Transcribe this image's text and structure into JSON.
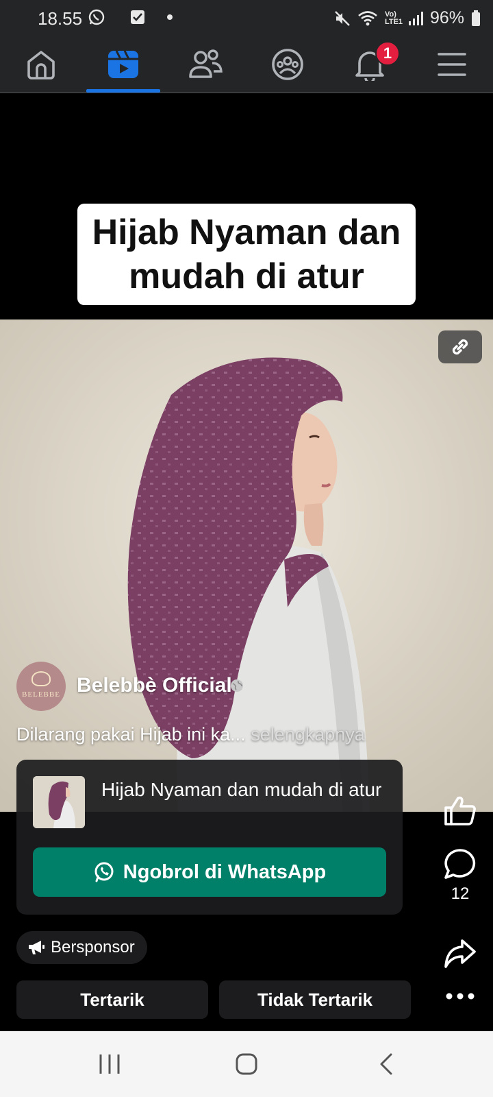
{
  "status_bar": {
    "time": "18.55",
    "network_label": "Vo) LTE1",
    "battery": "96%"
  },
  "nav": {
    "tabs": [
      {
        "name": "home",
        "icon": "home-icon"
      },
      {
        "name": "video",
        "icon": "video-icon",
        "active": true
      },
      {
        "name": "friends",
        "icon": "friends-icon"
      },
      {
        "name": "groups",
        "icon": "groups-icon"
      },
      {
        "name": "notifications",
        "icon": "bell-icon",
        "badge": "1"
      },
      {
        "name": "menu",
        "icon": "menu-icon"
      }
    ],
    "accent": "#1b74e4"
  },
  "video": {
    "caption": "Hijab Nyaman dan mudah di atur"
  },
  "post": {
    "author": "Belebbè Official",
    "avatar_text": "BELEBBE",
    "description": "Dilarang pakai Hijab ini ka...",
    "see_more": "selengkapnya"
  },
  "ad": {
    "title": "Hijab Nyaman dan mudah di atur",
    "cta_label": "Ngobrol di WhatsApp",
    "cta_color": "#008069"
  },
  "actions": {
    "like_icon": "thumbs-up-icon",
    "comment_icon": "comment-icon",
    "comment_count": "12",
    "share_icon": "share-icon",
    "more_icon": "more-icon"
  },
  "sponsored": {
    "label": "Bersponsor"
  },
  "choices": {
    "interested": "Tertarik",
    "not_interested": "Tidak Tertarik"
  }
}
